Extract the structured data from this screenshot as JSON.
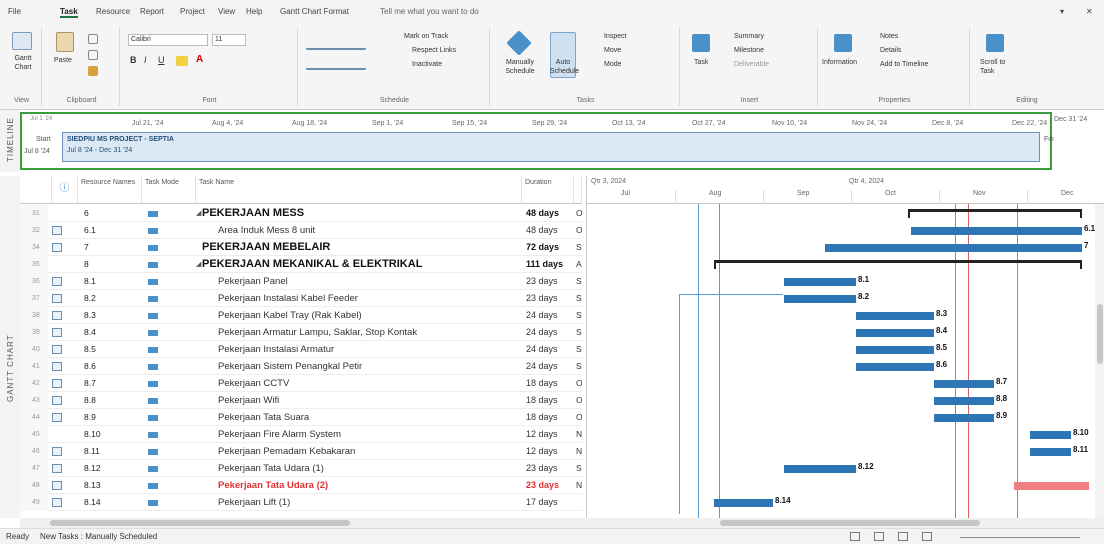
{
  "tabs": [
    "File",
    "Task",
    "Resource",
    "Report",
    "Project",
    "View",
    "Help",
    "Gantt Chart Format"
  ],
  "tell_me": "Tell me what you want to do",
  "ribbon": {
    "view_label": "Gantt Chart",
    "view_group": "View",
    "paste": "Paste",
    "clipboard_group": "Clipboard",
    "font_name": "Calibri",
    "font_size": "11",
    "font_group": "Font",
    "mark_on_track": "Mark on Track",
    "respect_links": "Respect Links",
    "inactivate": "Inactivate",
    "schedule_group": "Schedule",
    "manually": "Manually Schedule",
    "auto": "Auto Schedule",
    "inspect": "Inspect",
    "move": "Move",
    "mode": "Mode",
    "tasks_group": "Tasks",
    "task": "Task",
    "summary": "Summary",
    "milestone": "Milestone",
    "deliverable": "Deliverable",
    "insert_group": "Insert",
    "information": "Information",
    "notes": "Notes",
    "details": "Details",
    "add_to_timeline": "Add to Timeline",
    "properties_group": "Properties",
    "scroll": "Scroll to Task",
    "editing_group": "Editing"
  },
  "timeline": {
    "label": "TIMELINE",
    "start_label": "Start",
    "start_date": "Jul 8 '24",
    "finish_label": "Finish",
    "finish_date": "Dec 31 '24",
    "today": "Jul 1 '24",
    "dates": [
      "Jul 21, '24",
      "Aug 4, '24",
      "Aug 18, '24",
      "Sep 1, '24",
      "Sep 15, '24",
      "Sep 29, '24",
      "Oct 13, '24",
      "Oct 27, '24",
      "Nov 10, '24",
      "Nov 24, '24",
      "Dec 8, '24",
      "Dec 22, '24"
    ],
    "bar_title": "SIEDPIU MS PROJECT - SEPTIA",
    "bar_range": "Jul 8 '24 - Dec 31 '24"
  },
  "side_label": "GANTT CHART",
  "headers": {
    "resource": "Resource Names",
    "mode": "Task Mode",
    "name": "Task Name",
    "duration": "Duration"
  },
  "chart_headers": {
    "q1": "Qtr 3, 2024",
    "q2": "Qtr 4, 2024",
    "months": [
      "Jul",
      "Aug",
      "Sep",
      "Oct",
      "Nov",
      "Dec"
    ]
  },
  "rows": [
    {
      "n": "31",
      "ind": false,
      "res": "6",
      "name": "PEKERJAAN MESS",
      "dur": "48 days",
      "st": "O",
      "type": "summary-open",
      "indent": 0
    },
    {
      "n": "32",
      "ind": true,
      "res": "6.1",
      "name": "Area Induk Mess 8 unit",
      "dur": "48 days",
      "st": "O",
      "type": "task",
      "indent": 1
    },
    {
      "n": "34",
      "ind": true,
      "res": "7",
      "name": "PEKERJAAN MEBELAIR",
      "dur": "72 days",
      "st": "S",
      "type": "summary",
      "indent": 0
    },
    {
      "n": "35",
      "ind": false,
      "res": "8",
      "name": "PEKERJAAN MEKANIKAL & ELEKTRIKAL",
      "dur": "111 days",
      "st": "A",
      "type": "summary-open",
      "indent": 0
    },
    {
      "n": "36",
      "ind": true,
      "res": "8.1",
      "name": "Pekerjaan Panel",
      "dur": "23 days",
      "st": "S",
      "type": "task",
      "indent": 1
    },
    {
      "n": "37",
      "ind": true,
      "res": "8.2",
      "name": "Pekerjaan Instalasi Kabel Feeder",
      "dur": "23 days",
      "st": "S",
      "type": "task",
      "indent": 1
    },
    {
      "n": "38",
      "ind": true,
      "res": "8.3",
      "name": "Pekerjaan Kabel Tray (Rak Kabel)",
      "dur": "24 days",
      "st": "S",
      "type": "task",
      "indent": 1
    },
    {
      "n": "39",
      "ind": true,
      "res": "8.4",
      "name": "Pekerjaan Armatur Lampu, Saklar, Stop Kontak",
      "dur": "24 days",
      "st": "S",
      "type": "task",
      "indent": 1
    },
    {
      "n": "40",
      "ind": true,
      "res": "8.5",
      "name": "Pekerjaan Instalasi Armatur",
      "dur": "24 days",
      "st": "S",
      "type": "task",
      "indent": 1
    },
    {
      "n": "41",
      "ind": true,
      "res": "8.6",
      "name": "Pekerjaan Sistem Penangkal Petir",
      "dur": "24 days",
      "st": "S",
      "type": "task",
      "indent": 1
    },
    {
      "n": "42",
      "ind": true,
      "res": "8.7",
      "name": "Pekerjaan CCTV",
      "dur": "18 days",
      "st": "O",
      "type": "task",
      "indent": 1
    },
    {
      "n": "43",
      "ind": true,
      "res": "8.8",
      "name": "Pekerjaan Wifi",
      "dur": "18 days",
      "st": "O",
      "type": "task",
      "indent": 1
    },
    {
      "n": "44",
      "ind": true,
      "res": "8.9",
      "name": "Pekerjaan Tata Suara",
      "dur": "18 days",
      "st": "O",
      "type": "task",
      "indent": 1
    },
    {
      "n": "45",
      "ind": false,
      "res": "8.10",
      "name": "Pekerjaan Fire Alarm System",
      "dur": "12 days",
      "st": "N",
      "type": "task",
      "indent": 1
    },
    {
      "n": "46",
      "ind": true,
      "res": "8.11",
      "name": "Pekerjaan Pemadam Kebakaran",
      "dur": "12 days",
      "st": "N",
      "type": "task",
      "indent": 1
    },
    {
      "n": "47",
      "ind": true,
      "res": "8.12",
      "name": "Pekerjaan Tata Udara (1)",
      "dur": "23 days",
      "st": "S",
      "type": "task",
      "indent": 1
    },
    {
      "n": "48",
      "ind": true,
      "res": "8.13",
      "name": "Pekerjaan Tata Udara (2)",
      "dur": "23 days",
      "st": "N",
      "type": "critical",
      "indent": 1
    },
    {
      "n": "49",
      "ind": true,
      "res": "8.14",
      "name": "Pekerjaan Lift (1)",
      "dur": "17 days",
      "st": "",
      "type": "task",
      "indent": 1
    }
  ],
  "bars": [
    {
      "s": 0.62,
      "e": 0.955,
      "k": "sbar",
      "lbl": ""
    },
    {
      "s": 0.625,
      "e": 0.955,
      "k": "bar",
      "lbl": "6.1"
    },
    {
      "s": 0.46,
      "e": 0.955,
      "k": "bar",
      "lbl": "7"
    },
    {
      "s": 0.245,
      "e": 0.955,
      "k": "sbar",
      "lbl": ""
    },
    {
      "s": 0.38,
      "e": 0.52,
      "k": "bar",
      "lbl": "8.1"
    },
    {
      "s": 0.38,
      "e": 0.52,
      "k": "bar",
      "lbl": "8.2"
    },
    {
      "s": 0.52,
      "e": 0.67,
      "k": "bar",
      "lbl": "8.3"
    },
    {
      "s": 0.52,
      "e": 0.67,
      "k": "bar",
      "lbl": "8.4"
    },
    {
      "s": 0.52,
      "e": 0.67,
      "k": "bar",
      "lbl": "8.5"
    },
    {
      "s": 0.52,
      "e": 0.67,
      "k": "bar",
      "lbl": "8.6"
    },
    {
      "s": 0.67,
      "e": 0.785,
      "k": "bar",
      "lbl": "8.7"
    },
    {
      "s": 0.67,
      "e": 0.785,
      "k": "bar",
      "lbl": "8.8"
    },
    {
      "s": 0.67,
      "e": 0.785,
      "k": "bar",
      "lbl": "8.9"
    },
    {
      "s": 0.855,
      "e": 0.935,
      "k": "bar",
      "lbl": "8.10"
    },
    {
      "s": 0.855,
      "e": 0.935,
      "k": "bar",
      "lbl": "8.11"
    },
    {
      "s": 0.38,
      "e": 0.52,
      "k": "bar",
      "lbl": "8.12"
    },
    {
      "s": 0.825,
      "e": 0.97,
      "k": "red",
      "lbl": ""
    },
    {
      "s": 0.245,
      "e": 0.36,
      "k": "bar",
      "lbl": "8.14"
    }
  ],
  "status": {
    "ready": "Ready",
    "new_tasks": "New Tasks : Manually Scheduled"
  },
  "colors": {
    "bar": "#2e75b6",
    "red": "#f08080",
    "timeline_border": "#3a9c3a"
  }
}
